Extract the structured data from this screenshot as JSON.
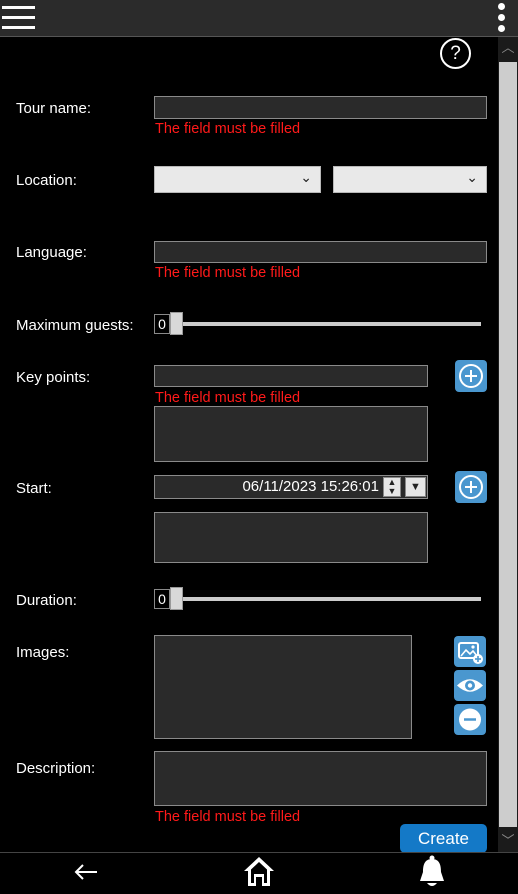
{
  "header": {
    "menu_icon": "hamburger-menu-icon",
    "more_icon": "more-vertical-icon"
  },
  "help": {
    "label": "?"
  },
  "form": {
    "tour_name": {
      "label": "Tour name:",
      "value": "",
      "error": "The field must be filled"
    },
    "location": {
      "label": "Location:",
      "country_value": "",
      "city_value": ""
    },
    "language": {
      "label": "Language:",
      "value": "",
      "error": "The field must be filled"
    },
    "max_guests": {
      "label": "Maximum guests:",
      "value": "0"
    },
    "key_points": {
      "label": "Key points:",
      "value": "",
      "error": "The field must be filled",
      "add_icon": "plus-circle-icon"
    },
    "start": {
      "label": "Start:",
      "value": "06/11/2023 15:26:01",
      "add_icon": "plus-circle-icon"
    },
    "duration": {
      "label": "Duration:",
      "value": "0"
    },
    "images": {
      "label": "Images:",
      "add_icon": "add-image-icon",
      "view_icon": "eye-icon",
      "remove_icon": "minus-circle-icon"
    },
    "description": {
      "label": "Description:",
      "value": "",
      "error": "The field must be filled"
    }
  },
  "actions": {
    "create_label": "Create"
  },
  "bottom_nav": {
    "back_icon": "back-arrow-icon",
    "home_icon": "home-icon",
    "notifications_icon": "bell-icon"
  },
  "colors": {
    "error": "#ff1a1a",
    "accent": "#1479c7",
    "icon_button": "#4a97cf"
  }
}
